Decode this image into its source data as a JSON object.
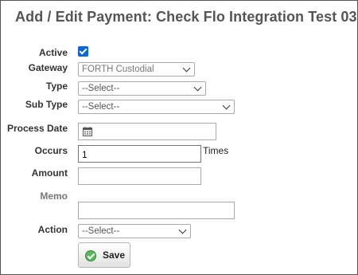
{
  "title": "Add / Edit Payment: Check Flo Integration Test 03",
  "form": {
    "active_label": "Active",
    "gateway_label": "Gateway",
    "gateway_value": "FORTH Custodial",
    "type_label": "Type",
    "type_value": "--Select--",
    "subtype_label": "Sub Type",
    "subtype_value": "--Select--",
    "process_date_label": "Process Date",
    "process_date_value": "",
    "occurs_label": "Occurs",
    "occurs_value": "1",
    "occurs_suffix": "Times",
    "amount_label": "Amount",
    "amount_value": "",
    "memo_label": "Memo",
    "memo_value": "",
    "action_label": "Action",
    "action_value": "--Select--",
    "save_label": "Save"
  },
  "icons": {
    "calendar": "calendar-icon",
    "save": "check-circle-icon"
  },
  "colors": {
    "checkbox": "#0b66d6",
    "save_icon": "#5cb85c",
    "title": "#555555"
  }
}
